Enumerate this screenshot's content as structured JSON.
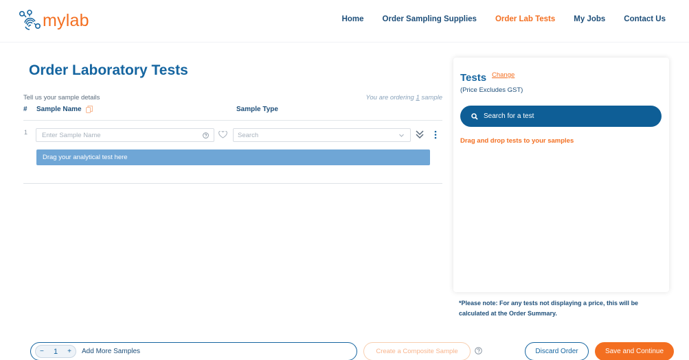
{
  "brand": {
    "name": "mylab",
    "accent": "#f36f21",
    "primary": "#1565a0"
  },
  "nav": {
    "home": "Home",
    "supplies": "Order Sampling Supplies",
    "lab_tests": "Order Lab Tests",
    "jobs": "My Jobs",
    "contact": "Contact Us",
    "active": "Order Lab Tests"
  },
  "main": {
    "title": "Order Laboratory Tests",
    "subtitle": "Tell us your sample details",
    "ordering_prefix": "You are ordering ",
    "ordering_count": "1",
    "ordering_suffix": " sample",
    "col_hash": "#",
    "col_name": "Sample Name",
    "col_type": "Sample Type",
    "rows": [
      {
        "number": "1",
        "name_placeholder": "Enter Sample Name",
        "name_value": "",
        "type_placeholder": "Search",
        "drop_label": "Drag your analytical test here"
      }
    ]
  },
  "panel": {
    "title": "Tests",
    "change": "Change",
    "price_note": "(Price Excludes GST)",
    "search_label": "Search for a test",
    "drag_hint": "Drag and drop tests to your samples"
  },
  "note": "*Please note: For any tests not displaying a price, this will be calculated at the Order Summary.",
  "footer": {
    "stepper_minus": "−",
    "quantity": "1",
    "stepper_plus": "+",
    "add_label": "Add More Samples",
    "composite_label": "Create a Composite Sample",
    "discard_label": "Discard Order",
    "save_label": "Save and Continue"
  }
}
